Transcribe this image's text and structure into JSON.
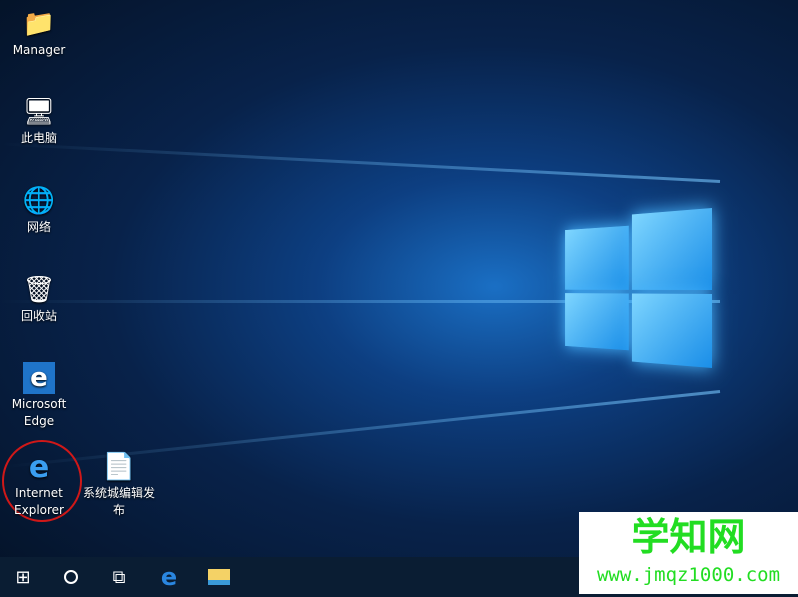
{
  "desktop": {
    "icons": [
      {
        "label": "Manager",
        "glyph": "📁"
      },
      {
        "label": "此电脑",
        "glyph": "🖥"
      },
      {
        "label": "网络",
        "glyph": "🌐"
      },
      {
        "label": "回收站",
        "glyph": "🗑"
      },
      {
        "label": "Microsoft Edge",
        "glyph": "e"
      },
      {
        "label": "Internet Explorer",
        "glyph": "e"
      },
      {
        "label": "系统城编辑发布",
        "glyph": "📄"
      }
    ]
  },
  "taskbar": {
    "start": "start-icon",
    "search": "cortana-icon",
    "taskview": "task-view-icon",
    "edge": "edge-icon",
    "explorer": "file-explorer-icon"
  },
  "watermark": {
    "title": "学知网",
    "url": "www.jmqz1000.com"
  },
  "colors": {
    "highlight": "#d01818",
    "taskbar": "#0a1d33",
    "watermark": "#22dd22"
  }
}
